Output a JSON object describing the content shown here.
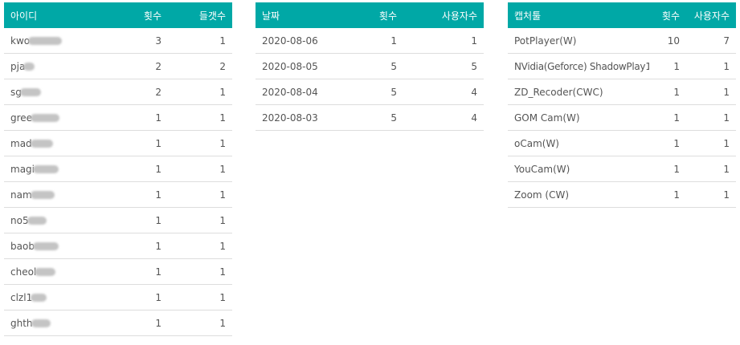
{
  "user_table": {
    "headers": {
      "id": "아이디",
      "count": "횟수",
      "device_count": "들갯수"
    },
    "rows": [
      {
        "id": "kwo",
        "count": "3",
        "device_count": "1"
      },
      {
        "id": "pja",
        "count": "2",
        "device_count": "2"
      },
      {
        "id": "sg",
        "count": "2",
        "device_count": "1"
      },
      {
        "id": "gree",
        "count": "1",
        "device_count": "1"
      },
      {
        "id": "mad",
        "count": "1",
        "device_count": "1"
      },
      {
        "id": "magi",
        "count": "1",
        "device_count": "1"
      },
      {
        "id": "nam",
        "count": "1",
        "device_count": "1"
      },
      {
        "id": "no5",
        "count": "1",
        "device_count": "1"
      },
      {
        "id": "baob",
        "count": "1",
        "device_count": "1"
      },
      {
        "id": "cheol",
        "count": "1",
        "device_count": "1"
      },
      {
        "id": "clzl1",
        "count": "1",
        "device_count": "1"
      },
      {
        "id": "ghth",
        "count": "1",
        "device_count": "1"
      }
    ]
  },
  "date_table": {
    "headers": {
      "date": "날짜",
      "count": "횟수",
      "users": "사용자수"
    },
    "rows": [
      {
        "date": "2020-08-06",
        "count": "1",
        "users": "1"
      },
      {
        "date": "2020-08-05",
        "count": "5",
        "users": "5"
      },
      {
        "date": "2020-08-04",
        "count": "5",
        "users": "4"
      },
      {
        "date": "2020-08-03",
        "count": "5",
        "users": "4"
      }
    ]
  },
  "capture_table": {
    "headers": {
      "tool": "캡처툴",
      "count": "횟수",
      "users": "사용자수"
    },
    "rows": [
      {
        "tool": "PotPlayer(W)",
        "count": "10",
        "users": "7"
      },
      {
        "tool": "NVidia(Geforce) ShadowPlay1",
        "count": "1",
        "users": "1"
      },
      {
        "tool": "ZD_Recoder(CWC)",
        "count": "1",
        "users": "1"
      },
      {
        "tool": "GOM Cam(W)",
        "count": "1",
        "users": "1"
      },
      {
        "tool": "oCam(W)",
        "count": "1",
        "users": "1"
      },
      {
        "tool": "YouCam(W)",
        "count": "1",
        "users": "1"
      },
      {
        "tool": "Zoom (CW)",
        "count": "1",
        "users": "1"
      }
    ]
  }
}
